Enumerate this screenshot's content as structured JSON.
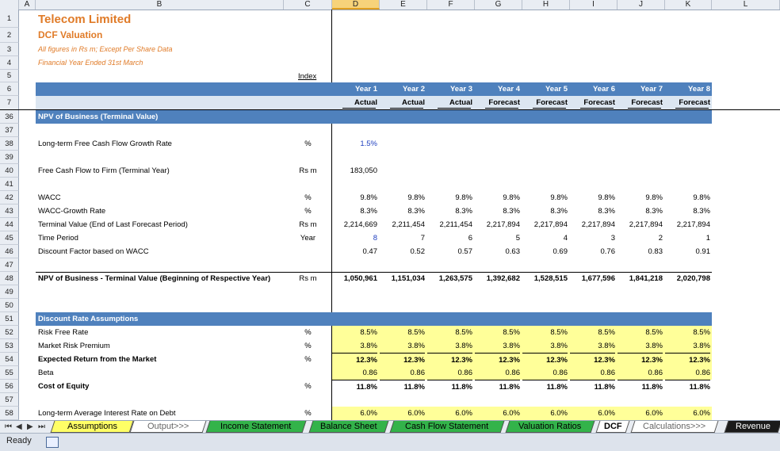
{
  "columns": [
    "A",
    "B",
    "C",
    "D",
    "E",
    "F",
    "G",
    "H",
    "I",
    "J",
    "K",
    "L"
  ],
  "rows": [
    "1",
    "2",
    "3",
    "4",
    "5",
    "6",
    "7",
    "36",
    "37",
    "38",
    "39",
    "40",
    "41",
    "42",
    "43",
    "44",
    "45",
    "46",
    "47",
    "48",
    "49",
    "50",
    "51",
    "52",
    "53",
    "54",
    "55",
    "56",
    "57",
    "58"
  ],
  "title": "Telecom Limited",
  "subtitle": "DCF Valuation",
  "note1": "All figures in Rs m; Except Per Share Data",
  "note2": "Financial Year Ended 31st March",
  "index_link": "Index",
  "years": [
    "Year 1",
    "Year 2",
    "Year 3",
    "Year 4",
    "Year 5",
    "Year 6",
    "Year 7",
    "Year 8"
  ],
  "types": [
    "Actual",
    "Actual",
    "Actual",
    "Forecast",
    "Forecast",
    "Forecast",
    "Forecast",
    "Forecast"
  ],
  "section_npv": "NPV of Business (Terminal Value)",
  "row38": {
    "label": "Long-term Free Cash Flow Growth Rate",
    "unit": "%",
    "value": "1.5%"
  },
  "row40": {
    "label": "Free Cash Flow to Firm (Terminal Year)",
    "unit": "Rs m",
    "value": "183,050"
  },
  "row42": {
    "label": "WACC",
    "unit": "%",
    "values": [
      "9.8%",
      "9.8%",
      "9.8%",
      "9.8%",
      "9.8%",
      "9.8%",
      "9.8%",
      "9.8%"
    ]
  },
  "row43": {
    "label": "WACC-Growth Rate",
    "unit": "%",
    "values": [
      "8.3%",
      "8.3%",
      "8.3%",
      "8.3%",
      "8.3%",
      "8.3%",
      "8.3%",
      "8.3%"
    ]
  },
  "row44": {
    "label": "Terminal Value (End of Last Forecast Period)",
    "unit": "Rs m",
    "values": [
      "2,214,669",
      "2,211,454",
      "2,211,454",
      "2,217,894",
      "2,217,894",
      "2,217,894",
      "2,217,894",
      "2,217,894"
    ]
  },
  "row45": {
    "label": "Time Period",
    "unit": "Year",
    "values": [
      "8",
      "7",
      "6",
      "5",
      "4",
      "3",
      "2",
      "1"
    ]
  },
  "row46": {
    "label": "Discount Factor based on WACC",
    "unit": "",
    "values": [
      "0.47",
      "0.52",
      "0.57",
      "0.63",
      "0.69",
      "0.76",
      "0.83",
      "0.91"
    ]
  },
  "row48": {
    "label": "NPV of Business - Terminal Value (Beginning of Respective Year)",
    "unit": "Rs m",
    "values": [
      "1,050,961",
      "1,151,034",
      "1,263,575",
      "1,392,682",
      "1,528,515",
      "1,677,596",
      "1,841,218",
      "2,020,798"
    ]
  },
  "section_disc": "Discount Rate Assumptions",
  "row52": {
    "label": "Risk Free Rate",
    "unit": "%",
    "values": [
      "8.5%",
      "8.5%",
      "8.5%",
      "8.5%",
      "8.5%",
      "8.5%",
      "8.5%",
      "8.5%"
    ]
  },
  "row53": {
    "label": "Market Risk Premium",
    "unit": "%",
    "values": [
      "3.8%",
      "3.8%",
      "3.8%",
      "3.8%",
      "3.8%",
      "3.8%",
      "3.8%",
      "3.8%"
    ]
  },
  "row54": {
    "label": "Expected Return from the Market",
    "unit": "%",
    "values": [
      "12.3%",
      "12.3%",
      "12.3%",
      "12.3%",
      "12.3%",
      "12.3%",
      "12.3%",
      "12.3%"
    ]
  },
  "row55": {
    "label": "Beta",
    "unit": "",
    "values": [
      "0.86",
      "0.86",
      "0.86",
      "0.86",
      "0.86",
      "0.86",
      "0.86",
      "0.86"
    ]
  },
  "row56": {
    "label": "Cost of Equity",
    "unit": "%",
    "values": [
      "11.8%",
      "11.8%",
      "11.8%",
      "11.8%",
      "11.8%",
      "11.8%",
      "11.8%",
      "11.8%"
    ]
  },
  "row58": {
    "label": "Long-term Average Interest Rate on Debt",
    "unit": "%",
    "values": [
      "6.0%",
      "6.0%",
      "6.0%",
      "6.0%",
      "6.0%",
      "6.0%",
      "6.0%",
      "6.0%"
    ]
  },
  "tabs": [
    "Assumptions",
    "Output>>>",
    "Income Statement",
    "Balance Sheet",
    "Cash Flow Statement",
    "Valuation Ratios",
    "DCF",
    "Calculations>>>",
    "Revenue"
  ],
  "nav_glyphs": [
    "⏮",
    "◀",
    "▶",
    "⏭"
  ],
  "status": "Ready",
  "colors": {
    "band": "#4f81bd",
    "lightband": "#dce6f1",
    "yellow": "#ffff99",
    "title": "#e07b28",
    "input_blue": "#1f3fbf"
  }
}
